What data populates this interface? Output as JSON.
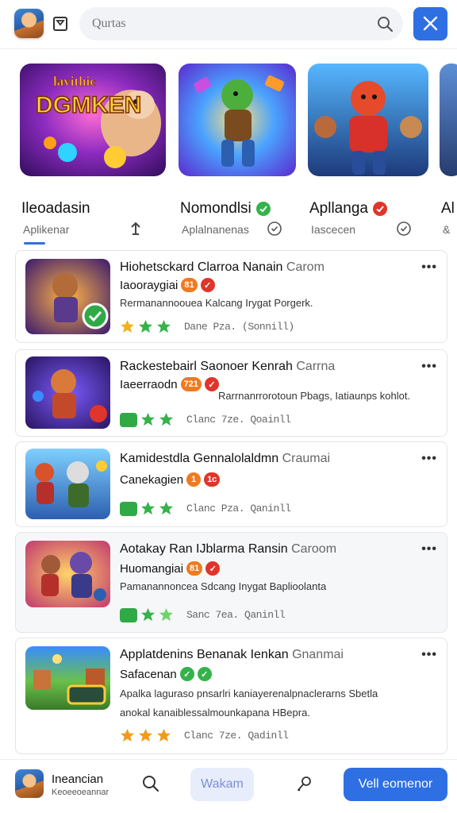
{
  "header": {
    "search_placeholder": "Qurtas",
    "search_value": ""
  },
  "colors": {
    "accent": "#2f6fe4",
    "verified_green": "#34b34a",
    "verified_red": "#e0352b",
    "star_gold": "#f3b020",
    "star_green": "#34b34a"
  },
  "featured": [
    {
      "banner": "DGMKEN",
      "banner_top": "lavithic",
      "title": "Ileoadasin",
      "subtitle": "Aplikenar",
      "badge": "",
      "action_icon": "download-icon"
    },
    {
      "title": "Nomondlsi",
      "subtitle": "Aplalnanenas",
      "badge": "green-check",
      "action_icon": "shield-check-icon"
    },
    {
      "title": "Apllanga",
      "subtitle": "Iascecen",
      "badge": "red-check",
      "action_icon": "shield-check-icon"
    },
    {
      "title": "Al",
      "subtitle": "&"
    }
  ],
  "list": [
    {
      "title": "Hiohetsckard Clarroa Nanain",
      "title_tail": "Carom",
      "subtitle": "Iaooraygiai",
      "pills": [
        "81",
        "✓"
      ],
      "description": "Rermanannoouea  Kalcang Irygat Porgerk.",
      "meta": "Dane Pza. (Sonnill)",
      "stars": [
        "gold",
        "green",
        "green"
      ]
    },
    {
      "title": "Rackestebairl Saonoer Kenrah",
      "title_tail": "Carrna",
      "subtitle": "Iaeerraodn",
      "pills": [
        "721",
        "✓"
      ],
      "description": "Rarrnanrrorotoun  Pbags, Iatiaunps kohlot.",
      "meta": "Clanc 7ze. Qoainll",
      "stars": [
        "badge",
        "green",
        "green"
      ]
    },
    {
      "title": "Kamidestdla Gennalolaldmn",
      "title_tail": "Craumai",
      "subtitle": "Canekagien",
      "pills": [
        "1",
        "1c"
      ],
      "description": "",
      "meta": "Clanc Pza. Qaninll",
      "stars": [
        "badge",
        "green",
        "green"
      ]
    },
    {
      "title": "Aotakay Ran IJblarma Ransin",
      "title_tail": "Caroom",
      "subtitle": "Huomangiai",
      "pills": [
        "81",
        "✓"
      ],
      "description": "Pamanannoncea  Sdcang Inygat Baplioolanta",
      "meta": "Sanc 7ea. Qaninll",
      "stars": [
        "badge",
        "green",
        "green"
      ]
    },
    {
      "title": "Applatdenins Benanak Ienkan",
      "title_tail": "Gnanmai",
      "subtitle": "Safacenan",
      "pills": [
        "✓",
        "✓"
      ],
      "description": "Apalka laguraso pnsarlri kaniayerenalpnaclerarns Sbetla",
      "description2": "anokal kanaiblessalmounkapana  HBepra.",
      "meta": "Clanc 7ze. Qadinll",
      "stars": [
        "orange",
        "orange",
        "orange"
      ]
    }
  ],
  "bottom": {
    "user_name": "Ineancian",
    "user_sub": "Keoeeoeannar",
    "tab_label": "Wakam",
    "cta_label": "Vell eomenor"
  }
}
